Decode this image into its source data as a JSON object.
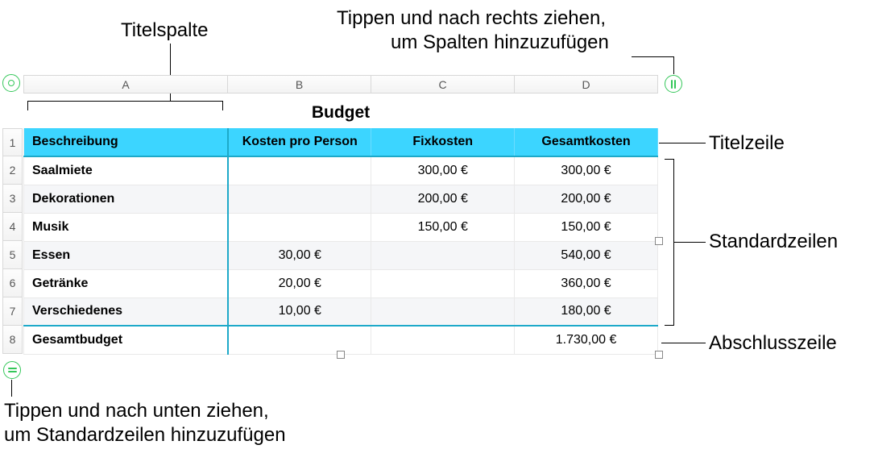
{
  "callouts": {
    "title_column": "Titelspalte",
    "drag_right_l1": "Tippen und nach rechts ziehen,",
    "drag_right_l2": "um Spalten hinzuzufügen",
    "header_row": "Titelzeile",
    "body_rows": "Standardzeilen",
    "footer_row": "Abschlusszeile",
    "drag_down_l1": "Tippen und nach unten ziehen,",
    "drag_down_l2": "um Standardzeilen hinzuzufügen"
  },
  "columns": [
    "A",
    "B",
    "C",
    "D"
  ],
  "row_numbers": [
    "1",
    "2",
    "3",
    "4",
    "5",
    "6",
    "7",
    "8"
  ],
  "table_title": "Budget",
  "headers": {
    "desc": "Beschreibung",
    "per_person": "Kosten pro Person",
    "fixed": "Fixkosten",
    "total": "Gesamtkosten"
  },
  "rows": [
    {
      "desc": "Saalmiete",
      "per_person": "",
      "fixed": "300,00 €",
      "total": "300,00 €"
    },
    {
      "desc": "Dekorationen",
      "per_person": "",
      "fixed": "200,00 €",
      "total": "200,00 €"
    },
    {
      "desc": "Musik",
      "per_person": "",
      "fixed": "150,00 €",
      "total": "150,00 €"
    },
    {
      "desc": "Essen",
      "per_person": "30,00 €",
      "fixed": "",
      "total": "540,00 €"
    },
    {
      "desc": "Getränke",
      "per_person": "20,00 €",
      "fixed": "",
      "total": "360,00 €"
    },
    {
      "desc": "Verschiedenes",
      "per_person": "10,00 €",
      "fixed": "",
      "total": "180,00 €"
    }
  ],
  "footer": {
    "desc": "Gesamtbudget",
    "per_person": "",
    "fixed": "",
    "total": "1.730,00 €"
  }
}
